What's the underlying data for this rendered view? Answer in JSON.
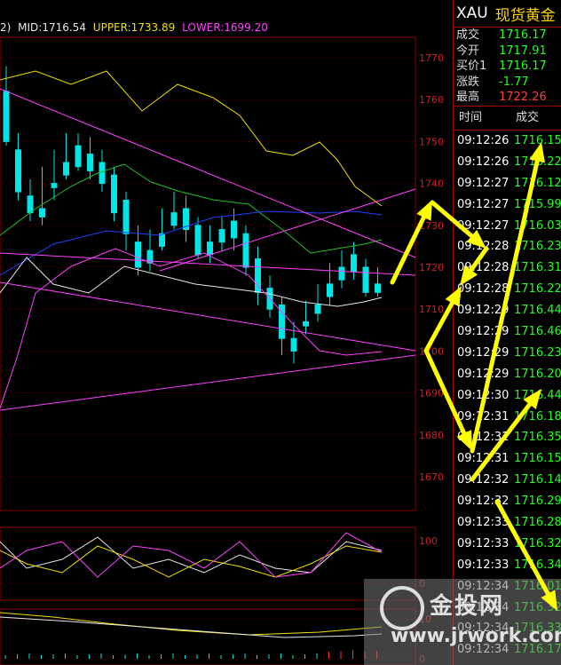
{
  "boll_header": {
    "period_suffix": "2)",
    "mid": "MID:1716.54",
    "upper": "UPPER:1733.89",
    "lower": "LOWER:1699.20"
  },
  "price_axis": {
    "ticks": [
      "1770",
      "1760",
      "1750",
      "1740",
      "1730",
      "1720",
      "1710",
      "1700",
      "1690",
      "1680",
      "1670"
    ]
  },
  "osc1_axis": {
    "ticks": [
      "100",
      "0"
    ]
  },
  "osc2_axis": {
    "ticks": [
      "10",
      "0"
    ]
  },
  "symbol": {
    "code": "XAU",
    "name": "现货黄金"
  },
  "quote": [
    {
      "label": "成交",
      "value": "1716.17",
      "color": "green"
    },
    {
      "label": "今开",
      "value": "1717.91",
      "color": "green"
    },
    {
      "label": "买价1",
      "value": "1716.17",
      "color": "green"
    },
    {
      "label": "涨跌",
      "value": "-1.77",
      "color": "green"
    },
    {
      "label": "最高",
      "value": "1722.26",
      "color": "red"
    }
  ],
  "ticks_header": {
    "time": "时间",
    "trade": "成交"
  },
  "ticks": [
    {
      "time": "09:12:26",
      "price": "1716.15"
    },
    {
      "time": "09:12:26",
      "price": "1716.22"
    },
    {
      "time": "09:12:27",
      "price": "1716.12"
    },
    {
      "time": "09:12:27",
      "price": "1715.99"
    },
    {
      "time": "09:12:27",
      "price": "1716.03"
    },
    {
      "time": "09:12:28",
      "price": "1716.23"
    },
    {
      "time": "09:12:28",
      "price": "1716.31"
    },
    {
      "time": "09:12:28",
      "price": "1716.22"
    },
    {
      "time": "09:12:29",
      "price": "1716.44"
    },
    {
      "time": "09:12:29",
      "price": "1716.46"
    },
    {
      "time": "09:12:29",
      "price": "1716.23"
    },
    {
      "time": "09:12:29",
      "price": "1716.20"
    },
    {
      "time": "09:12:30",
      "price": "1716.44"
    },
    {
      "time": "09:12:31",
      "price": "1716.18"
    },
    {
      "time": "09:12:31",
      "price": "1716.35"
    },
    {
      "time": "09:12:31",
      "price": "1716.15"
    },
    {
      "time": "09:12:32",
      "price": "1716.14"
    },
    {
      "time": "09:12:32",
      "price": "1716.29"
    },
    {
      "time": "09:12:33",
      "price": "1716.28"
    },
    {
      "time": "09:12:33",
      "price": "1716.32"
    },
    {
      "time": "09:12:33",
      "price": "1716.34"
    },
    {
      "time": "09:12:34",
      "price": "1716.01"
    },
    {
      "time": "09:12:34",
      "price": "1716.32"
    },
    {
      "time": "09:12:34",
      "price": "1716.33"
    },
    {
      "time": "09:12:34",
      "price": "1716.17"
    }
  ],
  "watermark": {
    "brand": "金投网",
    "url": "www.jrwork.com"
  },
  "colors": {
    "up_candle": "#ff3030",
    "down_candle": "#00e5e5",
    "grid": "#8b0000",
    "axis_text": "#d02020",
    "annotation_arrow": "#ffff00",
    "trendline": "#ff40ff",
    "ma_yellow": "#f0e000",
    "ma_green": "#20c020",
    "ma_blue": "#2040ff",
    "ma_white": "#e8e8e8",
    "price_green": "#22ff22"
  }
}
